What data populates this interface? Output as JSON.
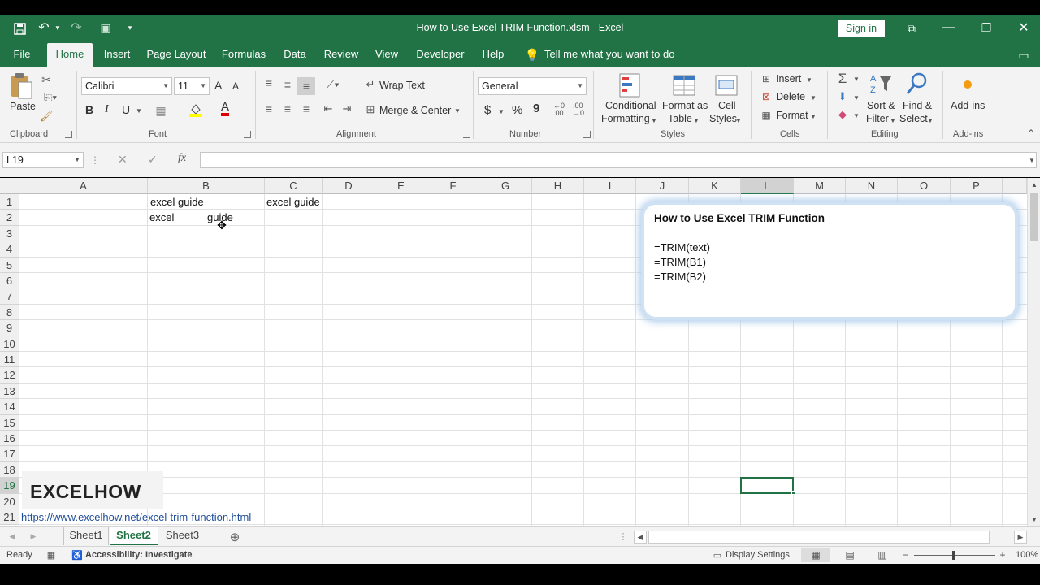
{
  "window": {
    "title": "How to Use Excel TRIM Function.xlsm  -  Excel",
    "sign_in": "Sign in"
  },
  "tabs": [
    "File",
    "Home",
    "Insert",
    "Page Layout",
    "Formulas",
    "Data",
    "Review",
    "View",
    "Developer",
    "Help"
  ],
  "tell_me": "Tell me what you want to do",
  "ribbon": {
    "clipboard": {
      "paste": "Paste",
      "label": "Clipboard"
    },
    "font": {
      "name": "Calibri",
      "size": "11",
      "bold": "B",
      "italic": "I",
      "underline": "U",
      "grow": "A",
      "shrink": "A",
      "color_letter": "A",
      "label": "Font"
    },
    "alignment": {
      "wrap": "Wrap Text",
      "merge": "Merge & Center",
      "label": "Alignment"
    },
    "number": {
      "format": "General",
      "currency": "$",
      "percent": "%",
      "comma": "9",
      "label": "Number"
    },
    "styles": {
      "cond1": "Conditional",
      "cond2": "Formatting",
      "fmt1": "Format as",
      "fmt2": "Table",
      "cell1": "Cell",
      "cell2": "Styles",
      "label": "Styles"
    },
    "cells": {
      "insert": "Insert",
      "delete": "Delete",
      "format": "Format",
      "label": "Cells"
    },
    "editing": {
      "sort1": "Sort &",
      "sort2": "Filter",
      "find1": "Find &",
      "find2": "Select",
      "label": "Editing"
    },
    "addins": {
      "btn": "Add-ins",
      "label": "Add-ins"
    }
  },
  "formula_bar": {
    "name_box": "L19",
    "fx": "fx",
    "cancel": "✕",
    "enter": "✓",
    "value": ""
  },
  "columns": [
    "A",
    "B",
    "C",
    "D",
    "E",
    "F",
    "G",
    "H",
    "I",
    "J",
    "K",
    "L",
    "M",
    "N",
    "O",
    "P"
  ],
  "rows": [
    "1",
    "2",
    "3",
    "4",
    "5",
    "6",
    "7",
    "8",
    "9",
    "10",
    "11",
    "12",
    "13",
    "14",
    "15",
    "16",
    "17",
    "18",
    "19",
    "20",
    "21"
  ],
  "cells": {
    "B1": " excel guide",
    "C1": "excel guide",
    "B2_word1": "excel",
    "B2_word2": "guide"
  },
  "textbox": {
    "title": "How to Use Excel TRIM Function",
    "lines": [
      "=TRIM(text)",
      "=TRIM(B1)",
      "=TRIM(B2)"
    ]
  },
  "watermark": {
    "brand": "EXCELHOW",
    "url": "https://www.excelhow.net/excel-trim-function.html"
  },
  "sheets": [
    "Sheet1",
    "Sheet2",
    "Sheet3"
  ],
  "active_sheet": "Sheet2",
  "status": {
    "ready": "Ready",
    "accessibility": "Accessibility: Investigate",
    "display": "Display Settings",
    "zoom": "100%"
  },
  "colors": {
    "accent": "#217346",
    "link": "#1f4e9c"
  }
}
